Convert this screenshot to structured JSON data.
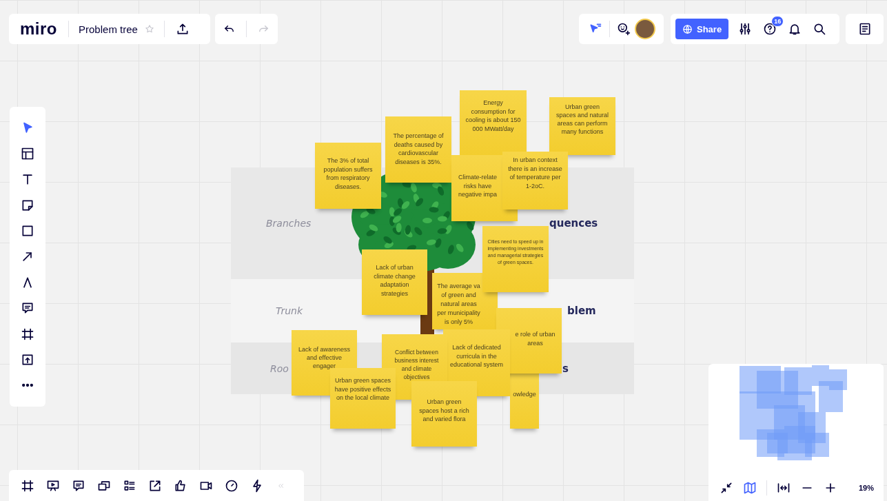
{
  "header": {
    "logo": "miro",
    "board_title": "Problem tree",
    "starred": false,
    "history": [
      {
        "kind": "undo",
        "disabled": false
      },
      {
        "kind": "redo",
        "disabled": true
      }
    ]
  },
  "collaboration": {
    "share_label": "Share",
    "help_badge": "16"
  },
  "tools": [
    {
      "kind": "select",
      "selected": true
    },
    {
      "kind": "templates",
      "selected": false
    },
    {
      "kind": "text",
      "selected": false
    },
    {
      "kind": "sticky",
      "selected": false
    },
    {
      "kind": "shape",
      "selected": false
    },
    {
      "kind": "line",
      "selected": false
    },
    {
      "kind": "pen",
      "selected": false
    },
    {
      "kind": "comment",
      "selected": false
    },
    {
      "kind": "frame",
      "selected": false
    },
    {
      "kind": "upload",
      "selected": false
    },
    {
      "kind": "more",
      "selected": false
    }
  ],
  "board": {
    "rows": [
      {
        "label": "Branches",
        "title": "quences"
      },
      {
        "label": "Trunk",
        "title": "blem"
      },
      {
        "label": "Roo",
        "title": "s"
      }
    ]
  },
  "sticky_notes": [
    {
      "text": "Energy consumption for cooling is about 150 000 MWatt/day"
    },
    {
      "text": "Urban green spaces and natural areas can perform many functions"
    },
    {
      "text": "The percentage of deaths caused by cardiovascular diseases is 35%."
    },
    {
      "text": "The 3% of total population suffers from respiratory diseases."
    },
    {
      "text": "In urban context there is an increase of temperature per 1-2oC."
    },
    {
      "text": "Climate-relate risks have negative impa"
    },
    {
      "text": "Cities need to speed up in implementing investments and managerial strategies of green spaces."
    },
    {
      "text": "Lack of urban climate change adaptation strategies"
    },
    {
      "text": "The average va of green and natural areas per municipality is only 5%"
    },
    {
      "text": "e role of urban areas"
    },
    {
      "text": "Lack of awareness and effective engager"
    },
    {
      "text": "Conflict between business interest and climate objectives"
    },
    {
      "text": "Lack of dedicated curricula in the educational system"
    },
    {
      "text": "owledge"
    },
    {
      "text": "Urban green spaces have positive effects on the local climate"
    },
    {
      "text": "Urban green spaces host a rich and varied flora"
    }
  ],
  "navigation": {
    "minimap_visible": true,
    "zoom_label": "19%"
  }
}
